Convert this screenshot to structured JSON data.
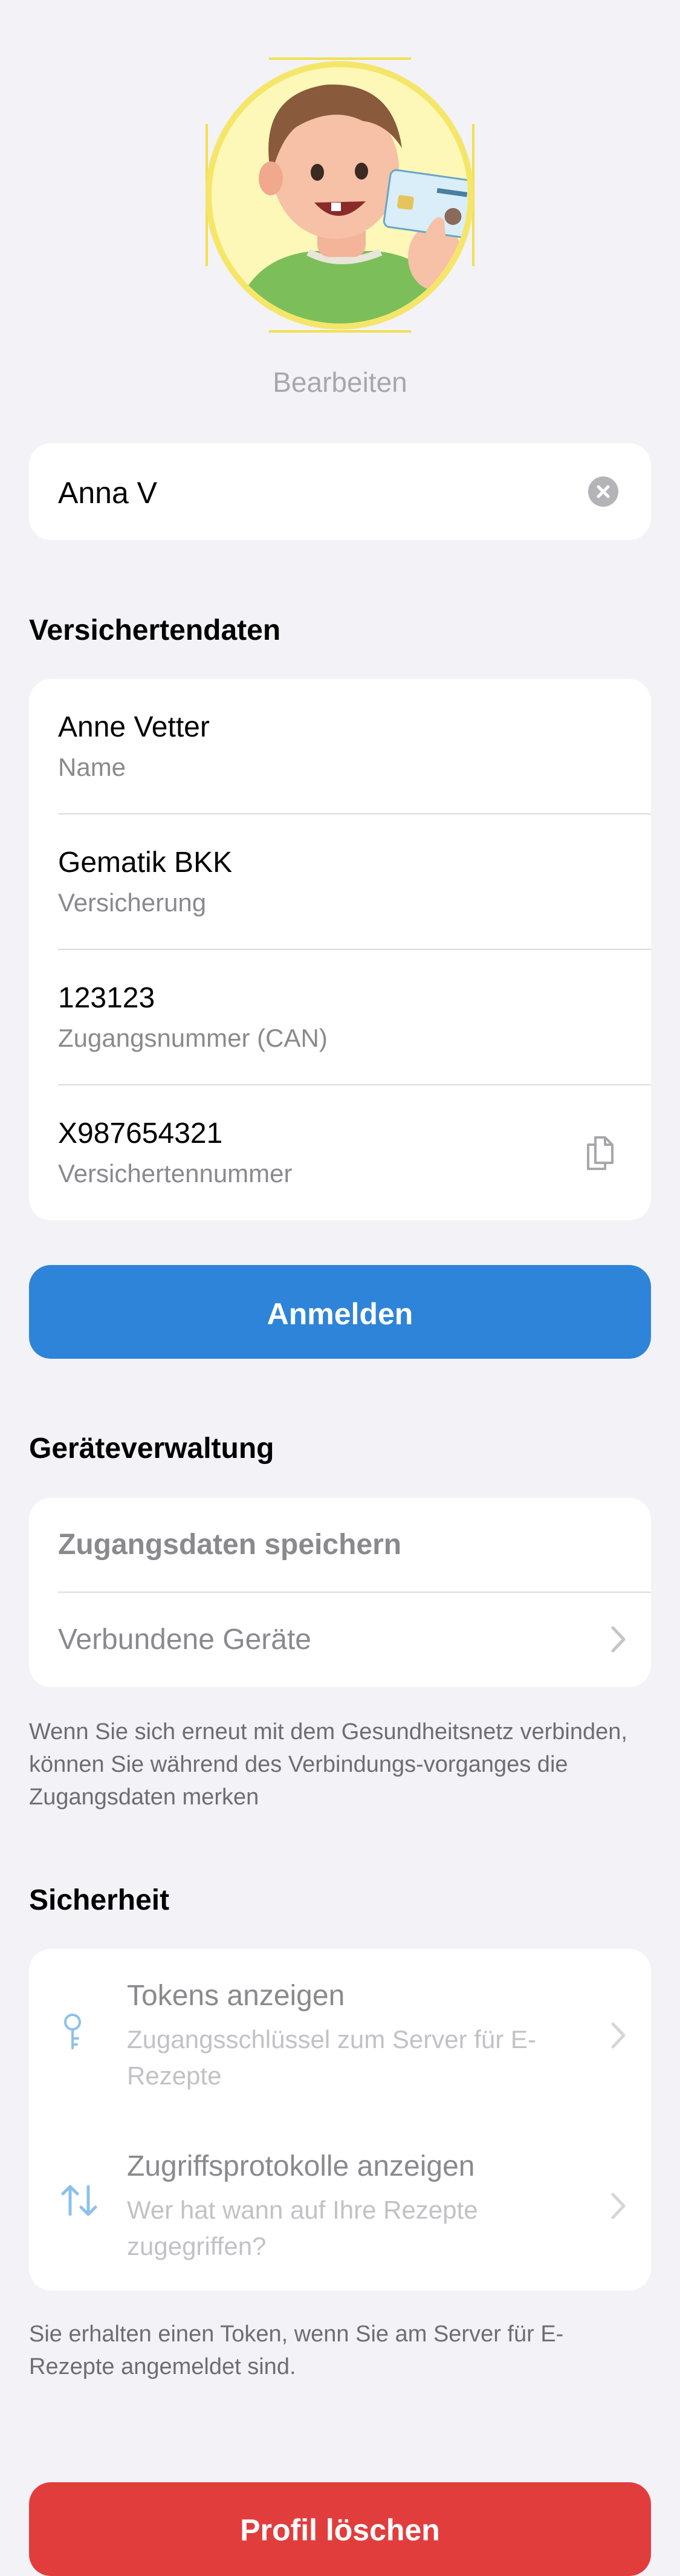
{
  "profile": {
    "edit_label": "Bearbeiten",
    "name_value": "Anna V"
  },
  "insured": {
    "section_title": "Versichertendaten",
    "rows": [
      {
        "value": "Anne Vetter",
        "label": "Name"
      },
      {
        "value": "Gematik BKK",
        "label": "Versicherung"
      },
      {
        "value": "123123",
        "label": "Zugangsnummer (CAN)"
      },
      {
        "value": "X987654321",
        "label": "Versichertennummer"
      }
    ],
    "login_button": "Anmelden"
  },
  "devices": {
    "section_title": "Geräteverwaltung",
    "save_credentials": "Zugangsdaten speichern",
    "connected_devices": "Verbundene Geräte",
    "footnote": "Wenn Sie sich erneut mit dem Gesundheitsnetz verbinden, können Sie während des Verbindungs-vorganges die Zugangsdaten merken"
  },
  "security": {
    "section_title": "Sicherheit",
    "items": [
      {
        "title": "Tokens anzeigen",
        "subtitle": "Zugangsschlüssel zum Server für E-Rezepte",
        "icon": "key-icon"
      },
      {
        "title": "Zugriffsprotokolle anzeigen",
        "subtitle": "Wer hat wann auf Ihre Rezepte zugegriffen?",
        "icon": "arrows-up-down-icon"
      }
    ],
    "footnote": "Sie erhalten einen Token, wenn Sie am Server für E-Rezepte angemeldet sind."
  },
  "delete_button": "Profil löschen",
  "colors": {
    "background": "#f2f2f7",
    "primary_blue": "#2e84d8",
    "danger_red": "#e23d3d",
    "avatar_ring": "#f5e66a"
  }
}
